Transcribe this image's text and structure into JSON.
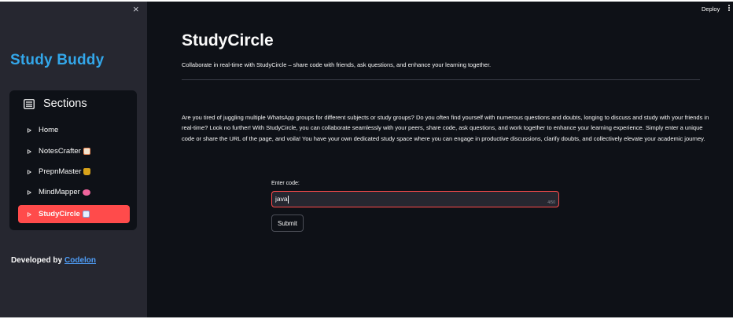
{
  "topbar": {
    "deploy_label": "Deploy"
  },
  "sidebar": {
    "close_glyph": "×",
    "brand": "Study Buddy",
    "menu_title": "Sections",
    "items": [
      {
        "label": "Home",
        "emoji": ""
      },
      {
        "label": "NotesCrafter",
        "emoji": "memo"
      },
      {
        "label": "PrepnMaster",
        "emoji": "trophy"
      },
      {
        "label": "MindMapper",
        "emoji": "brain"
      },
      {
        "label": "StudyCircle",
        "emoji": "book",
        "active": true
      }
    ],
    "footer_prefix": "Developed by",
    "footer_link": "Codelon"
  },
  "main": {
    "title": "StudyCircle",
    "subtitle": "Collaborate in real-time with StudyCircle – share code with friends, ask questions, and enhance your learning together.",
    "description": "Are you tired of juggling multiple WhatsApp groups for different subjects or study groups? Do you often find yourself with numerous questions and doubts, longing to discuss and study with your friends in real-time? Look no further! With StudyCircle, you can collaborate seamlessly with your peers, share code, ask questions, and work together to enhance your learning experience. Simply enter a unique code or share the URL of the page, and voila! You have your own dedicated study space where you can engage in productive discussions, clarify doubts, and collectively elevate your academic journey.",
    "code_label": "Enter code:",
    "code_value": "java",
    "code_counter": "4/50",
    "submit_label": "Submit"
  },
  "colors": {
    "accent": "#ff4b4b",
    "brand": "#33a7ea",
    "link": "#4f9ef8",
    "sidebar_bg": "#262730",
    "main_bg": "#0e1117"
  }
}
